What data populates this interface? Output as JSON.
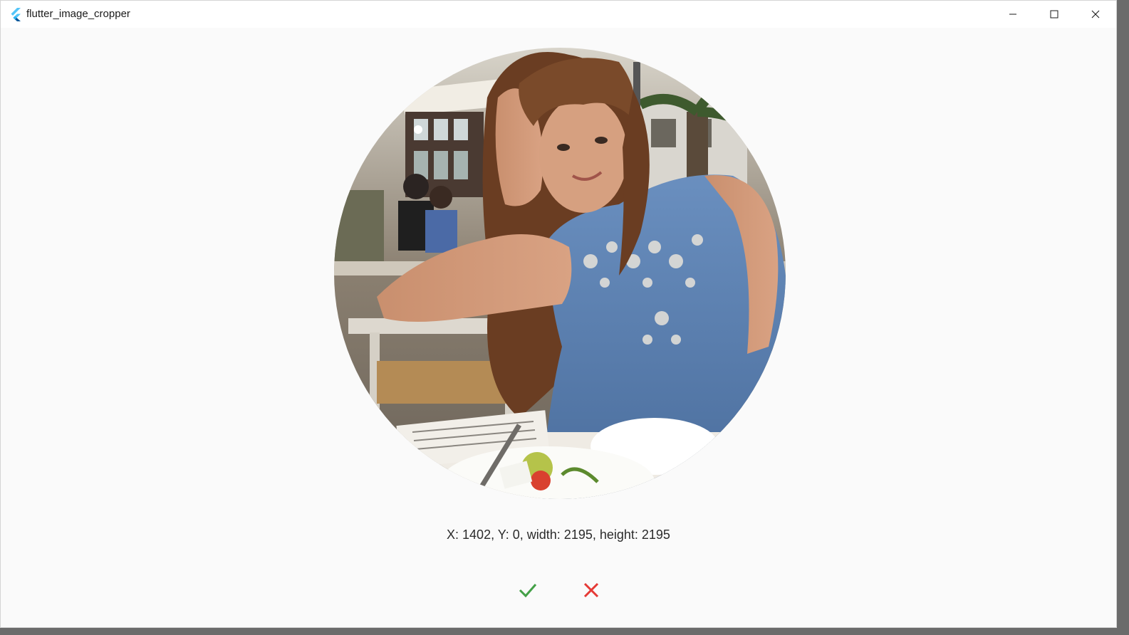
{
  "window": {
    "title": "flutter_image_cropper",
    "controls": {
      "minimize": "minimize-icon",
      "maximize": "maximize-icon",
      "close": "close-icon"
    }
  },
  "cropper": {
    "shape": "circle",
    "info_text": "X: 1402, Y: 0, width: 2195, height: 2195"
  },
  "actions": {
    "confirm_icon": "check-icon",
    "cancel_icon": "close-icon"
  },
  "colors": {
    "confirm": "#43a047",
    "cancel": "#e53935",
    "background": "#fafafa"
  }
}
